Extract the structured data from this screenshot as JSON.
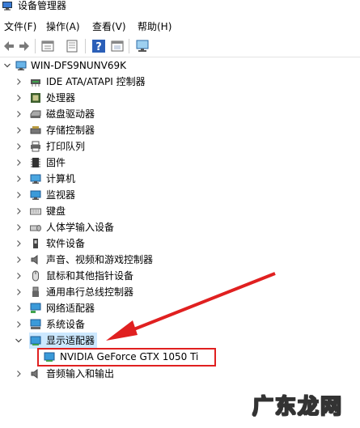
{
  "window": {
    "title": "设备管理器"
  },
  "menu": {
    "items": [
      "文件(F)",
      "操作(A)",
      "查看(V)",
      "帮助(H)"
    ]
  },
  "toolbar": {
    "buttons": [
      "back-arrow-icon",
      "forward-arrow-icon",
      "properties-icon",
      "update-driver-icon",
      "help-icon",
      "show-hidden-icon",
      "monitor-icon"
    ]
  },
  "tree": {
    "root": "WIN-DFS9NUNV69K",
    "categories": [
      {
        "label": "IDE ATA/ATAPI 控制器",
        "icon": "ide-controller-icon"
      },
      {
        "label": "处理器",
        "icon": "processor-icon"
      },
      {
        "label": "磁盘驱动器",
        "icon": "disk-drive-icon"
      },
      {
        "label": "存储控制器",
        "icon": "storage-controller-icon"
      },
      {
        "label": "打印队列",
        "icon": "printer-icon"
      },
      {
        "label": "固件",
        "icon": "firmware-icon"
      },
      {
        "label": "计算机",
        "icon": "computer-icon"
      },
      {
        "label": "监视器",
        "icon": "monitor-icon"
      },
      {
        "label": "键盘",
        "icon": "keyboard-icon"
      },
      {
        "label": "人体学输入设备",
        "icon": "hid-icon"
      },
      {
        "label": "软件设备",
        "icon": "software-device-icon"
      },
      {
        "label": "声音、视频和游戏控制器",
        "icon": "sound-icon"
      },
      {
        "label": "鼠标和其他指针设备",
        "icon": "mouse-icon"
      },
      {
        "label": "通用串行总线控制器",
        "icon": "usb-icon"
      },
      {
        "label": "网络适配器",
        "icon": "network-adapter-icon"
      },
      {
        "label": "系统设备",
        "icon": "system-device-icon"
      },
      {
        "label": "显示适配器",
        "icon": "display-adapter-icon",
        "expanded": true
      },
      {
        "label": "音频输入和输出",
        "icon": "audio-io-icon"
      }
    ],
    "display_child": "NVIDIA GeForce GTX 1050 Ti"
  },
  "colors": {
    "annotation": "#e02020",
    "selection": "#cce8ff"
  },
  "watermark": {
    "text": "广东龙网"
  }
}
